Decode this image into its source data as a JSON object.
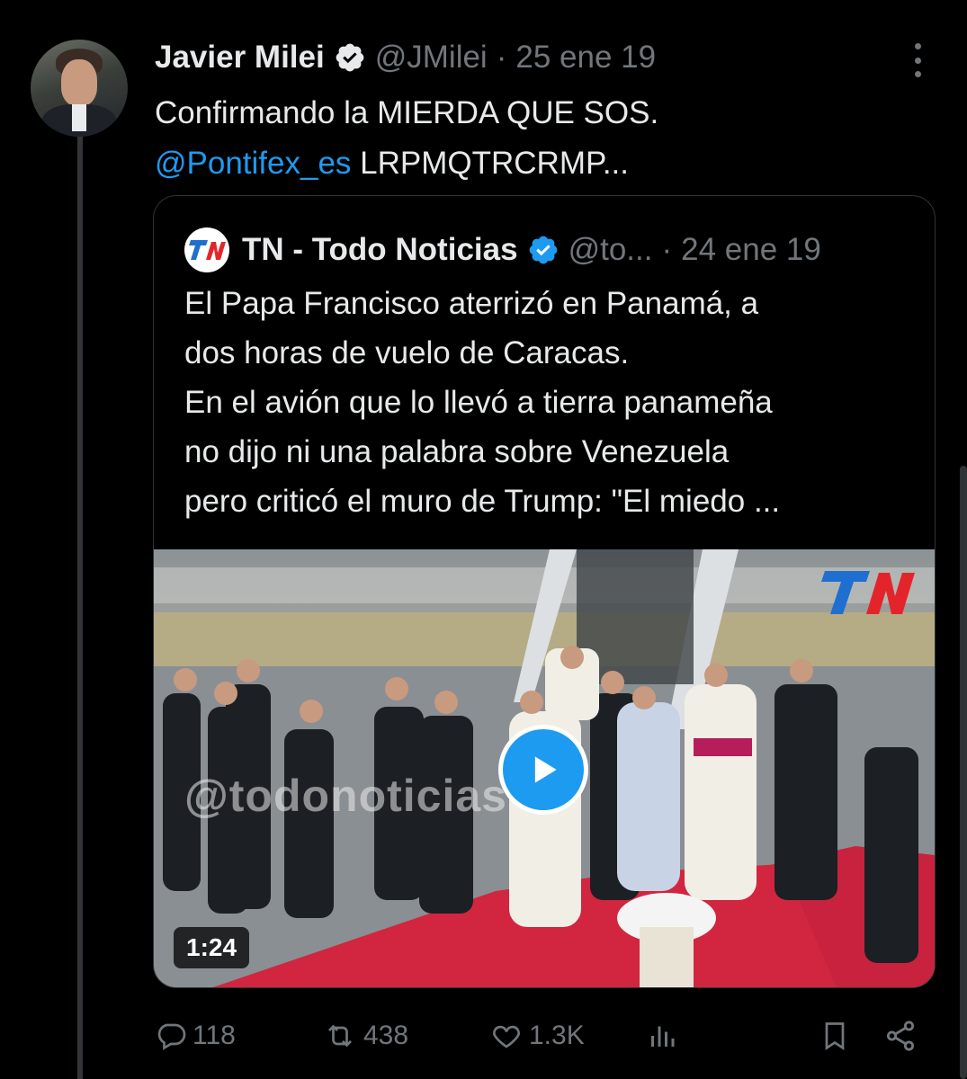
{
  "tweet": {
    "author_name": "Javier Milei",
    "handle": "@JMilei",
    "separator": "·",
    "date": "25 ene 19",
    "text_line1": "Confirmando la MIERDA QUE SOS.",
    "mention": "@Pontifex_es",
    "text_rest": " LRPMQTRCRMP..."
  },
  "quote": {
    "logo_text": "TN",
    "author_name": "TN - Todo Noticias",
    "handle": "@to...",
    "separator": "·",
    "date": "24 ene 19",
    "text_lines": [
      "El Papa Francisco aterrizó en Panamá, a",
      "dos horas de vuelo de Caracas.",
      "En el avión que lo llevó a tierra panameña",
      "no dijo ni una palabra sobre Venezuela",
      "pero criticó el muro de Trump: \"El miedo ..."
    ],
    "video": {
      "watermark": "@todonoticias",
      "brand_mark": "TN",
      "duration": "1:24"
    }
  },
  "actions": {
    "replies": "118",
    "reposts": "438",
    "likes": "1.3K"
  },
  "colors": {
    "background": "#000000",
    "text": "#e7e9ea",
    "muted": "#71767b",
    "accent": "#1d9bf0",
    "border": "#2f3336",
    "tn_red": "#e3252b",
    "tn_blue": "#1f6fd1"
  },
  "icons": [
    "more-icon",
    "verified-badge-icon",
    "tn-logo-icon",
    "play-icon",
    "reply-icon",
    "repost-icon",
    "like-icon",
    "views-icon",
    "bookmark-icon",
    "share-icon"
  ]
}
